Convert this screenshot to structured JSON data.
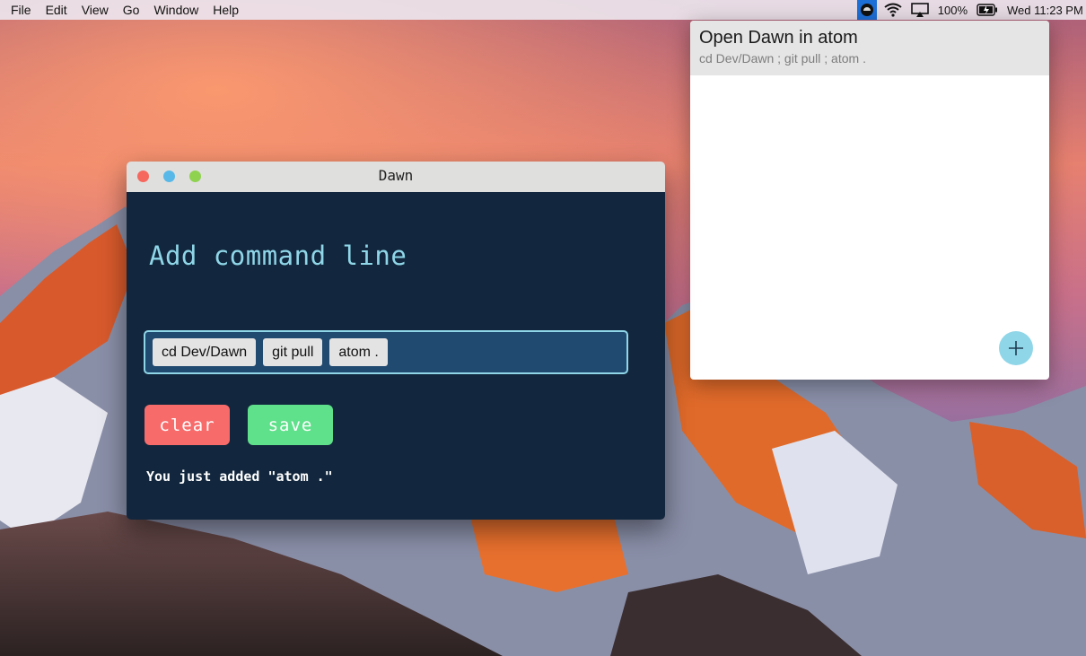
{
  "menubar": {
    "items": [
      "File",
      "Edit",
      "View",
      "Go",
      "Window",
      "Help"
    ],
    "battery_percent": "100%",
    "clock": "Wed 11:23 PM",
    "status_icons": [
      "dawn-app-icon",
      "wifi-icon",
      "airplay-icon",
      "battery-charging-icon"
    ]
  },
  "window": {
    "title": "Dawn",
    "heading": "Add command line",
    "chips": [
      "cd Dev/Dawn",
      "git pull",
      "atom ."
    ],
    "clear_label": "clear",
    "save_label": "save",
    "status_message": "You just added \"atom .\""
  },
  "popover": {
    "items": [
      {
        "title": "Open Dawn in atom",
        "command": "cd Dev/Dawn ; git pull ; atom ."
      }
    ],
    "add_icon": "plus-icon"
  },
  "colors": {
    "window_bg": "#12273d",
    "accent": "#8fd6e8",
    "input_bg": "#214a70",
    "clear": "#f76b6b",
    "save": "#5fe08a"
  }
}
